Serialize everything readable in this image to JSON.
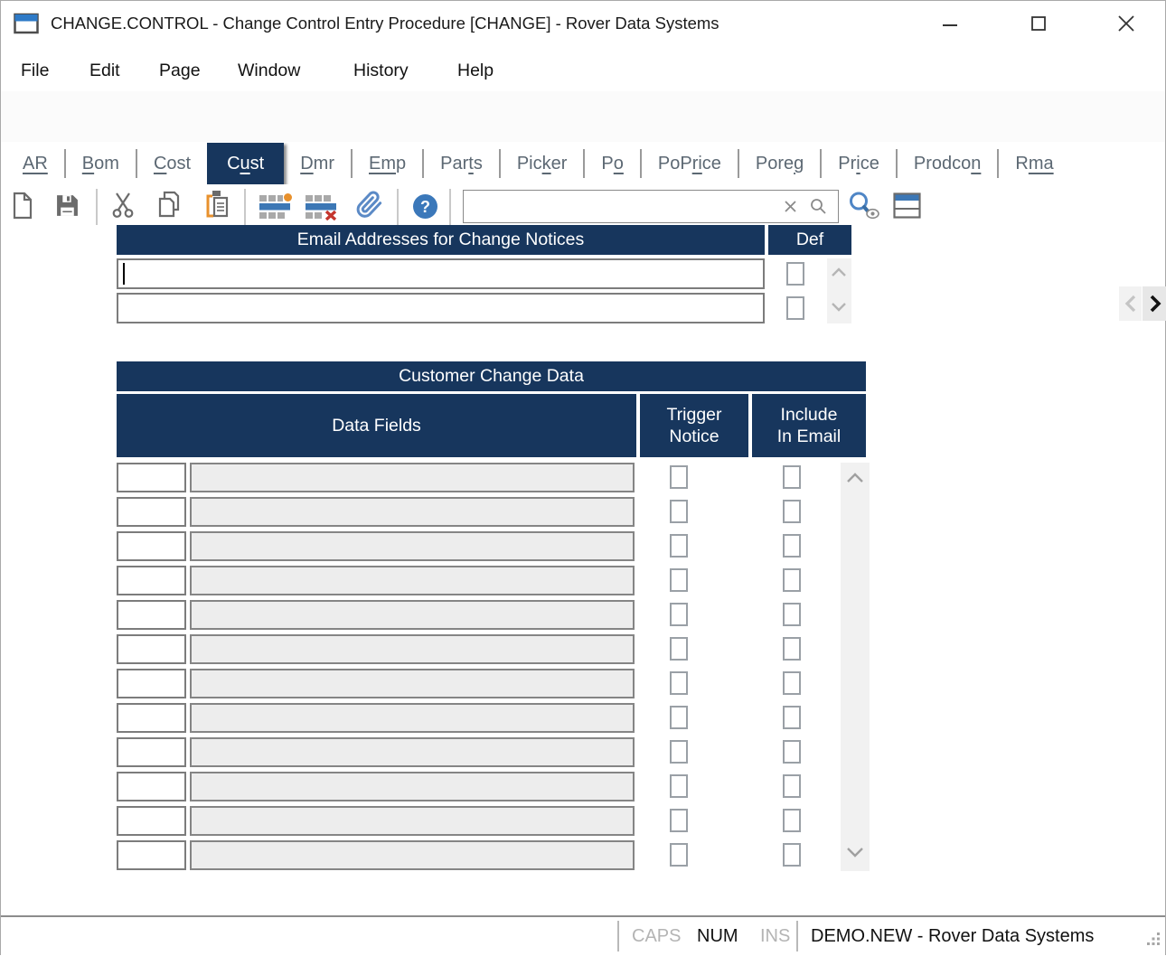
{
  "window": {
    "title": "CHANGE.CONTROL - Change Control Entry Procedure [CHANGE] - Rover Data Systems"
  },
  "menu": {
    "items": [
      "File",
      "Edit",
      "Page",
      "Window",
      "History",
      "Help"
    ]
  },
  "toolbar": {
    "icons": [
      "new-document-icon",
      "save-icon",
      "cut-icon",
      "copy-icon",
      "paste-icon",
      "insert-row-icon",
      "delete-row-icon",
      "attachment-icon",
      "help-icon",
      "clear-search-icon",
      "search-icon",
      "search-view-icon",
      "layout-icon"
    ],
    "search": {
      "value": "",
      "placeholder": ""
    }
  },
  "tabs": {
    "items": [
      {
        "pre": "",
        "hot": "AR",
        "post": "",
        "selected": false
      },
      {
        "pre": "",
        "hot": "B",
        "post": "om",
        "selected": false
      },
      {
        "pre": "",
        "hot": "C",
        "post": "ost",
        "selected": false
      },
      {
        "pre": "C",
        "hot": "u",
        "post": "st",
        "selected": true
      },
      {
        "pre": "",
        "hot": "D",
        "post": "mr",
        "selected": false
      },
      {
        "pre": "",
        "hot": "Em",
        "post": "p",
        "selected": false
      },
      {
        "pre": "Par",
        "hot": "t",
        "post": "s",
        "selected": false
      },
      {
        "pre": "Pic",
        "hot": "k",
        "post": "er",
        "selected": false
      },
      {
        "pre": "P",
        "hot": "o",
        "post": "",
        "selected": false
      },
      {
        "pre": "PoP",
        "hot": "ri",
        "post": "ce",
        "selected": false
      },
      {
        "pre": "Pore",
        "hot": "g",
        "post": "",
        "selected": false
      },
      {
        "pre": "Pr",
        "hot": "i",
        "post": "ce",
        "selected": false
      },
      {
        "pre": "Prodco",
        "hot": "n",
        "post": "",
        "selected": false
      },
      {
        "pre": "R",
        "hot": "ma",
        "post": "",
        "selected": false
      }
    ],
    "scroll_left_enabled": false,
    "scroll_right_enabled": true
  },
  "email_table": {
    "title": "Email Addresses for Change Notices",
    "def_header": "Def",
    "rows": [
      {
        "email": "",
        "def_checked": false,
        "focused": true
      },
      {
        "email": "",
        "def_checked": false,
        "focused": false
      }
    ]
  },
  "customer_table": {
    "title": "Customer Change Data",
    "col_data_fields": "Data Fields",
    "col_trigger_line1": "Trigger",
    "col_trigger_line2": "Notice",
    "col_include_line1": "Include",
    "col_include_line2": "In Email",
    "row_count": 12,
    "rows_all_empty": true,
    "checkboxes_all_unchecked": true
  },
  "status_bar": {
    "caps": "CAPS",
    "num": "NUM",
    "ins": "INS",
    "caps_active": false,
    "num_active": true,
    "ins_active": false,
    "session": "DEMO.NEW - Rover Data Systems"
  },
  "colors": {
    "navy": "#17365d",
    "blue": "#3c77b5",
    "orange": "#e8912d",
    "red": "#c4362e"
  }
}
